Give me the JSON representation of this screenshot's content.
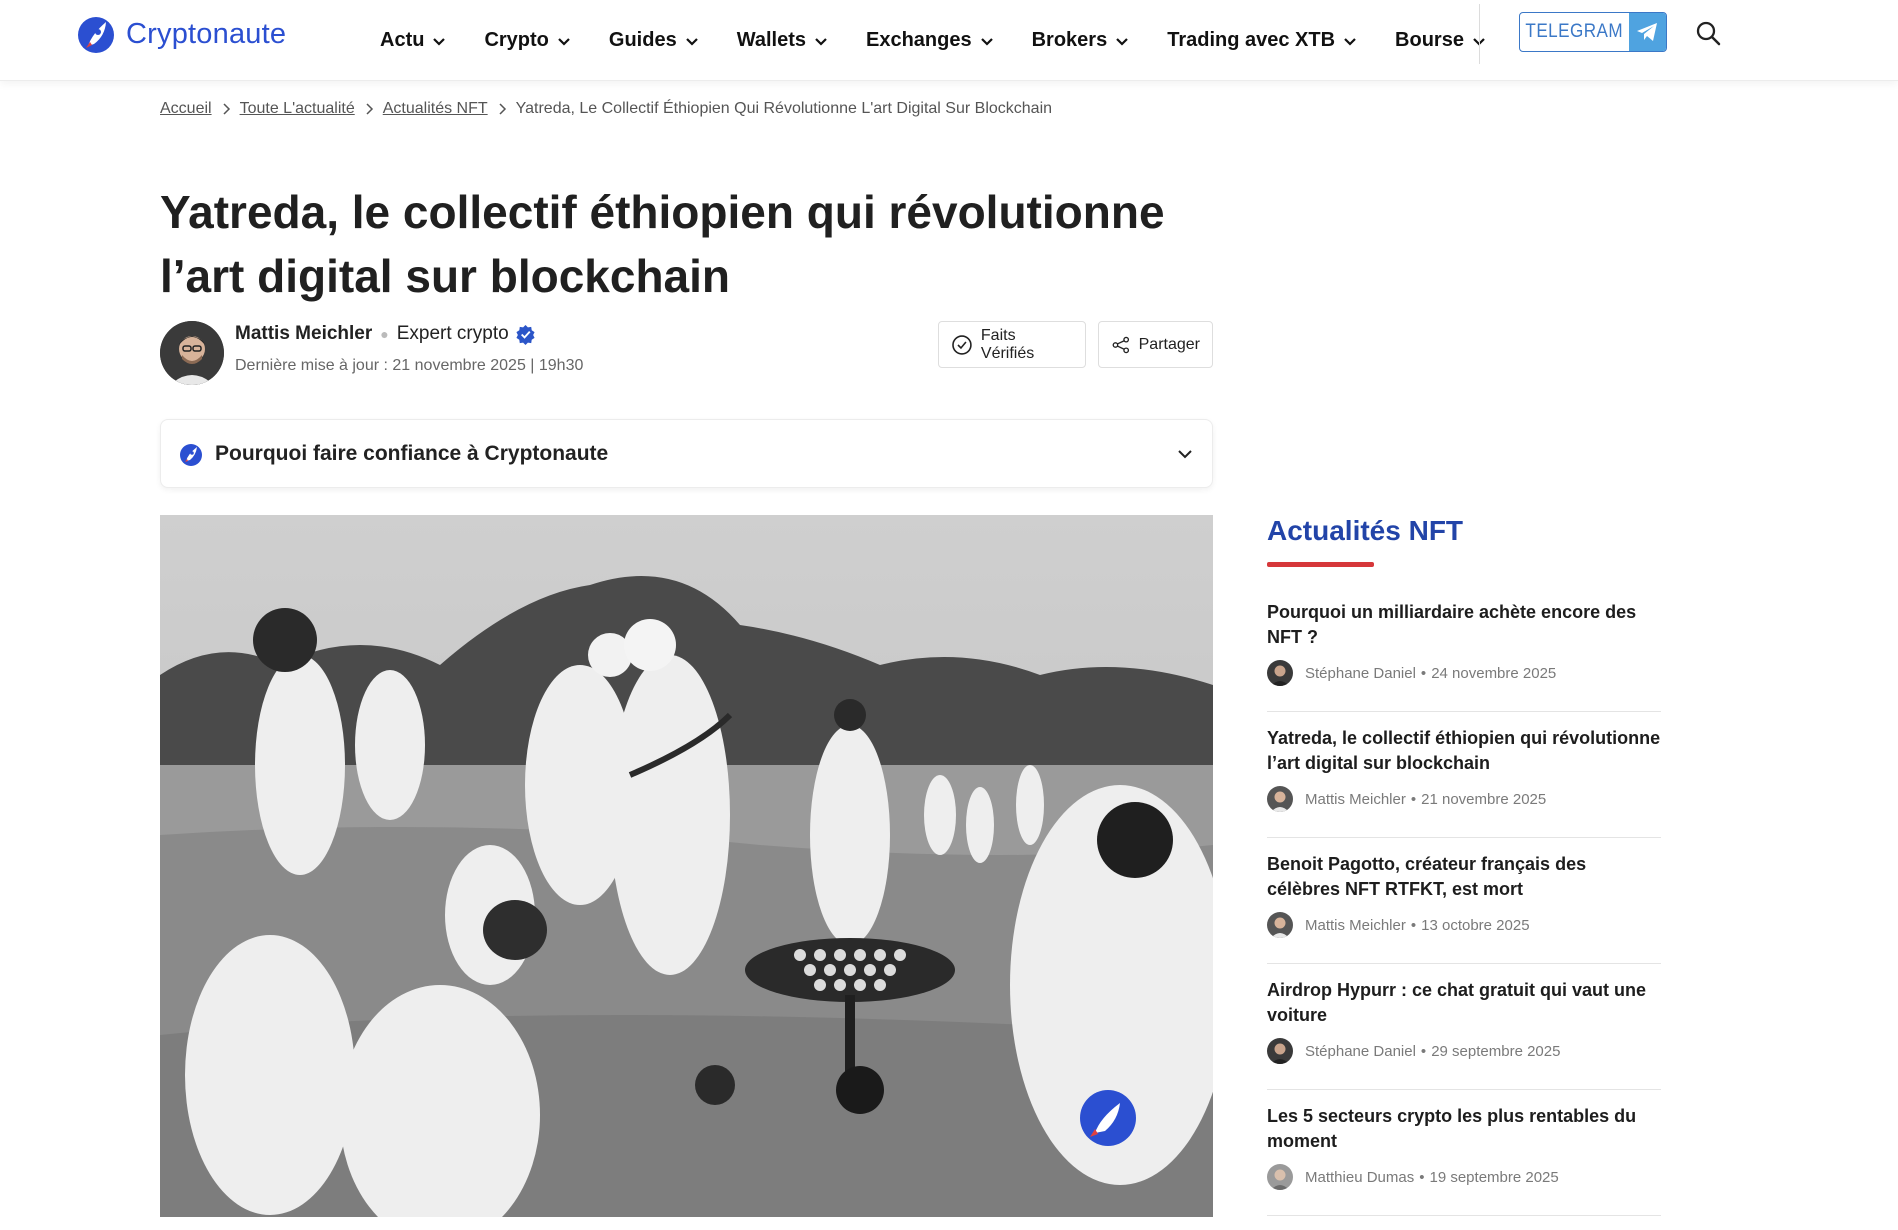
{
  "header": {
    "logo_text": "Cryptonaute",
    "nav": [
      "Actu",
      "Crypto",
      "Guides",
      "Wallets",
      "Exchanges",
      "Brokers",
      "Trading avec XTB",
      "Bourse"
    ],
    "telegram_label": "TELEGRAM",
    "icons": {
      "search": "search-icon",
      "telegram": "paper-plane-icon",
      "dropdown": "chevron-down-icon"
    }
  },
  "breadcrumb": {
    "items": [
      "Accueil",
      "Toute L'actualité",
      "Actualités NFT"
    ],
    "current": "Yatreda, Le Collectif Éthiopien Qui Révolutionne L'art Digital Sur Blockchain"
  },
  "article": {
    "title": "Yatreda, le collectif éthiopien qui révolutionne l’art digital sur blockchain",
    "author_name": "Mattis Meichler",
    "author_role": "Expert crypto",
    "updated_label": "Dernière mise à jour :",
    "updated_value": "21 novembre 2025 | 19h30",
    "faits_label": "Faits Vérifiés",
    "share_label": "Partager",
    "trust_label": "Pourquoi faire confiance à Cryptonaute"
  },
  "sidebar": {
    "title": "Actualités NFT",
    "accent_color": "#d6373a",
    "title_color": "#2244a8",
    "items": [
      {
        "title": "Pourquoi un milliardaire achète encore des NFT ?",
        "author": "Stéphane Daniel",
        "date": "24 novembre 2025"
      },
      {
        "title": "Yatreda, le collectif éthiopien qui révolutionne l’art digital sur blockchain",
        "author": "Mattis Meichler",
        "date": "21 novembre 2025"
      },
      {
        "title": "Benoit Pagotto, créateur français des célèbres NFT RTFKT, est mort",
        "author": "Mattis Meichler",
        "date": "13 octobre 2025"
      },
      {
        "title": "Airdrop Hypurr : ce chat gratuit qui vaut une voiture",
        "author": "Stéphane Daniel",
        "date": "29 septembre 2025"
      },
      {
        "title": "Les 5 secteurs crypto les plus rentables du moment",
        "author": "Matthieu Dumas",
        "date": "19 septembre 2025"
      }
    ]
  },
  "colors": {
    "brand": "#2b4fd1",
    "telegram": "#3b78c7"
  }
}
